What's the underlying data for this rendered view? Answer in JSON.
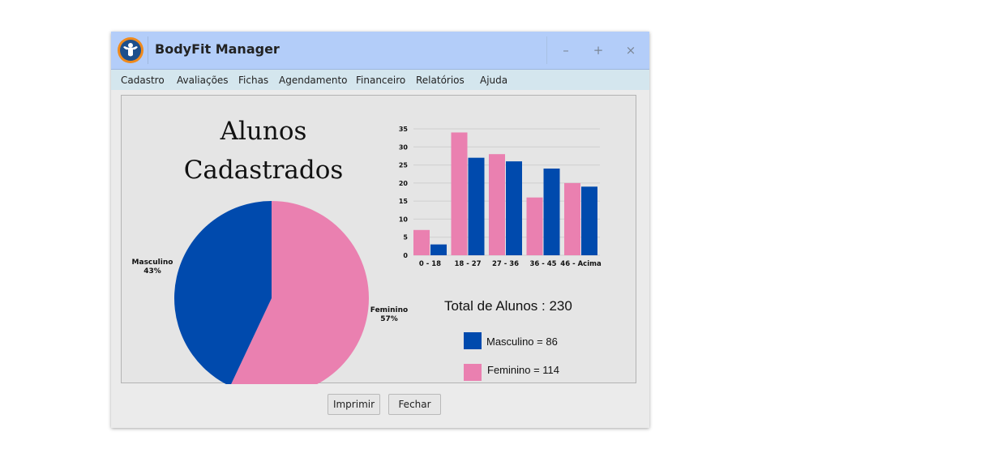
{
  "window": {
    "title": "BodyFit Manager",
    "controls": {
      "minimize": "–",
      "maximize": "+",
      "close": "×"
    }
  },
  "menu": [
    "Cadastro",
    "Avaliações",
    "Fichas",
    "Agendamento",
    "Financeiro",
    "Relatórios",
    "Ajuda"
  ],
  "report": {
    "title_line1": "Alunos",
    "title_line2": "Cadastrados",
    "total": "Total de Alunos : 230",
    "legend": [
      {
        "label": "Masculino = 86",
        "color": "#004aad"
      },
      {
        "label": "Feminino = 114",
        "color": "#ea80b0"
      }
    ]
  },
  "colors": {
    "masculino": "#004aad",
    "feminino": "#ea80b0"
  },
  "chart_data": [
    {
      "type": "pie",
      "slices": [
        {
          "label": "Masculino",
          "value": 43,
          "pct_label": "43%",
          "color": "#004aad"
        },
        {
          "label": "Feminino",
          "value": 57,
          "pct_label": "57%",
          "color": "#ea80b0"
        }
      ]
    },
    {
      "type": "bar",
      "categories": [
        "0 - 18",
        "18 - 27",
        "27 - 36",
        "36 - 45",
        "46 - Acima"
      ],
      "series": [
        {
          "color": "#ea80b0",
          "values": [
            7,
            34,
            28,
            16,
            20
          ]
        },
        {
          "color": "#004aad",
          "values": [
            3,
            27,
            26,
            24,
            19
          ]
        }
      ],
      "ylim": [
        0,
        35
      ],
      "yticks": [
        0,
        5,
        10,
        15,
        20,
        25,
        30,
        35
      ],
      "grid": true
    }
  ],
  "buttons": {
    "print": "Imprimir",
    "close": "Fechar"
  }
}
